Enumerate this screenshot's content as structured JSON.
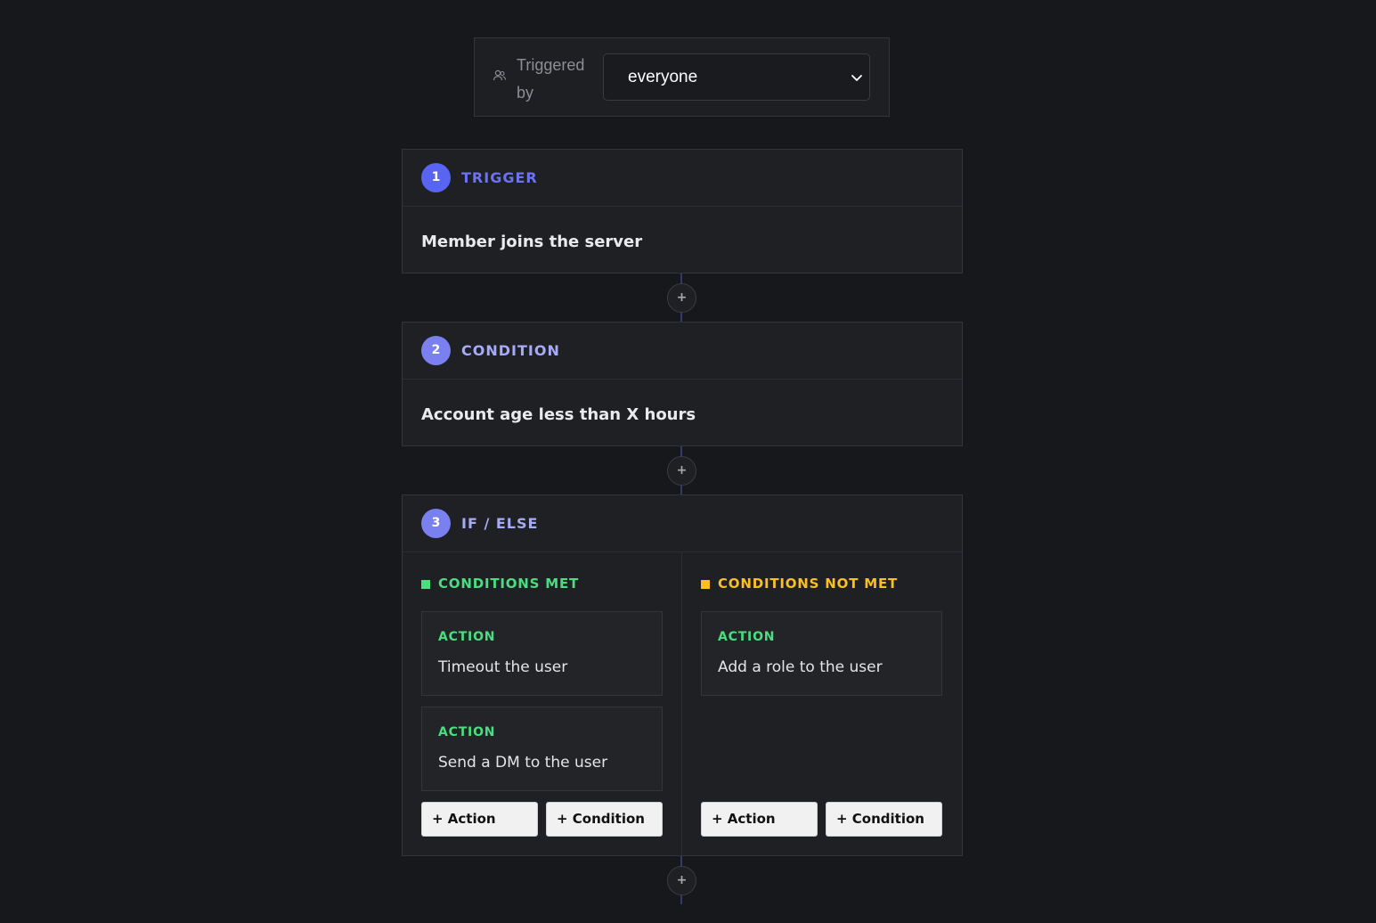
{
  "header": {
    "icon": "users-icon",
    "label": "Triggered by",
    "select_value": "everyone"
  },
  "steps": [
    {
      "number": "1",
      "title": "TRIGGER",
      "body": "Member joins the server",
      "accent": "#5865f2",
      "title_color": "#6a72f5"
    },
    {
      "number": "2",
      "title": "CONDITION",
      "body": "Account age less than X hours",
      "accent": "#7a80f0",
      "title_color": "#a6abf7"
    },
    {
      "number": "3",
      "title": "IF / ELSE",
      "accent": "#7a80f0",
      "title_color": "#a6abf7"
    }
  ],
  "add_step_symbol": "+",
  "branches": {
    "met": {
      "title": "CONDITIONS MET",
      "color": "#4ade80",
      "actions": [
        {
          "kind": "ACTION",
          "desc": "Timeout the user"
        },
        {
          "kind": "ACTION",
          "desc": "Send a DM to the user"
        }
      ],
      "add_action": "+ Action",
      "add_condition": "+ Condition"
    },
    "not_met": {
      "title": "CONDITIONS NOT MET",
      "color": "#fbbf24",
      "actions": [
        {
          "kind": "ACTION",
          "desc": "Add a role to the user"
        }
      ],
      "add_action": "+ Action",
      "add_condition": "+ Condition"
    }
  }
}
